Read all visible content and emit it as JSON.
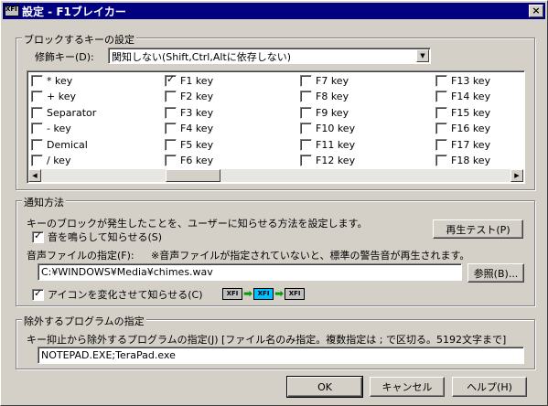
{
  "window": {
    "title": "設定 - F1ブレイカー",
    "close": "×"
  },
  "block_group": {
    "legend": "ブロックするキーの設定",
    "modifier_label": "修飾キー(D):",
    "modifier_value": "関知しない(Shift,Ctrl,Altに依存しない)",
    "keys": [
      [
        {
          "label": "* key",
          "checked": false
        },
        {
          "label": "+ key",
          "checked": false
        },
        {
          "label": "Separator",
          "checked": false
        },
        {
          "label": "- key",
          "checked": false
        },
        {
          "label": "Demical",
          "checked": false
        },
        {
          "label": "/ key",
          "checked": false
        }
      ],
      [
        {
          "label": "F1 key",
          "checked": true
        },
        {
          "label": "F2 key",
          "checked": false
        },
        {
          "label": "F3 key",
          "checked": false
        },
        {
          "label": "F4 key",
          "checked": false
        },
        {
          "label": "F5 key",
          "checked": false
        },
        {
          "label": "F6 key",
          "checked": false
        }
      ],
      [
        {
          "label": "F7 key",
          "checked": false
        },
        {
          "label": "F8 key",
          "checked": false
        },
        {
          "label": "F9 key",
          "checked": false
        },
        {
          "label": "F10 key",
          "checked": false
        },
        {
          "label": "F11 key",
          "checked": false
        },
        {
          "label": "F12 key",
          "checked": false
        }
      ],
      [
        {
          "label": "F13 key",
          "checked": false
        },
        {
          "label": "F14 key",
          "checked": false
        },
        {
          "label": "F15 key",
          "checked": false
        },
        {
          "label": "F16 key",
          "checked": false
        },
        {
          "label": "F17 key",
          "checked": false
        },
        {
          "label": "F18 key",
          "checked": false
        }
      ]
    ]
  },
  "notify_group": {
    "legend": "通知方法",
    "description": "キーのブロックが発生したことを、ユーザーに知らせる方法を設定します。",
    "sound_checkbox": "音を鳴らして知らせる(S)",
    "sound_checked": true,
    "play_test_button": "再生テスト(P)",
    "sound_file_label": "音声ファイルの指定(F):",
    "sound_file_note": "※音声ファイルが指定されていないと、標準の警告音が再生されます。",
    "sound_file_value": "C:¥WINDOWS¥Media¥chimes.wav",
    "browse_button": "参照(B)...",
    "icon_checkbox": "アイコンを変化させて知らせる(C)",
    "icon_checked": true,
    "icon_text": "XFI"
  },
  "exclude_group": {
    "legend": "除外するプログラムの指定",
    "description": "キー抑止から除外するプログラムの指定(J) [ファイル名のみ指定。複数指定は ; で区切る。5192文字まで]",
    "value": "NOTEPAD.EXE;TeraPad.exe"
  },
  "buttons": {
    "ok": "OK",
    "cancel": "キャンセル",
    "help": "ヘルプ(H)"
  }
}
